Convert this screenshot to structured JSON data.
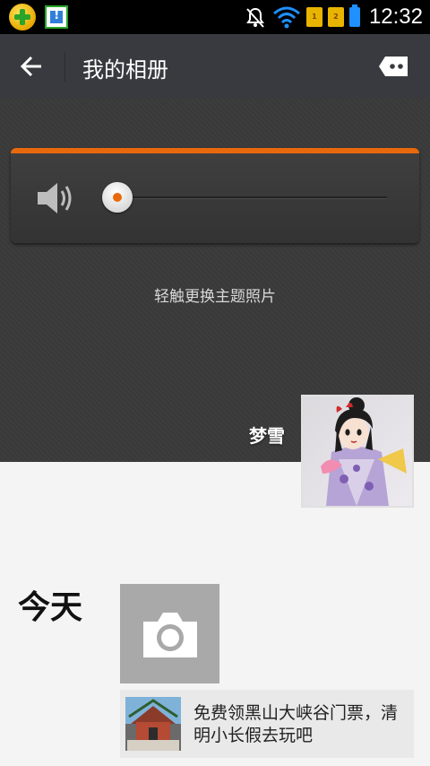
{
  "status_bar": {
    "time": "12:32",
    "icons": [
      "app-360-icon",
      "app-download-icon",
      "alarm-off-icon",
      "wifi-icon",
      "sim1-icon",
      "sim2-icon",
      "battery-icon"
    ]
  },
  "header": {
    "title": "我的相册",
    "back_icon": "arrow-left-icon",
    "more_icon": "message-more-icon"
  },
  "cover": {
    "hint": "轻触更换主题照片",
    "username": "梦雪",
    "player": {
      "volume_icon": "speaker-icon",
      "progress": 0
    }
  },
  "feed": {
    "day_label": "今天",
    "camera_icon": "camera-icon",
    "ad": {
      "text": "免费领黑山大峡谷门票，清明小长假去玩吧"
    }
  },
  "colors": {
    "accent": "#e8690b",
    "titlebar": "#393a3f",
    "cover_bg": "#3a3a3a",
    "page_bg": "#f4f4f4"
  }
}
